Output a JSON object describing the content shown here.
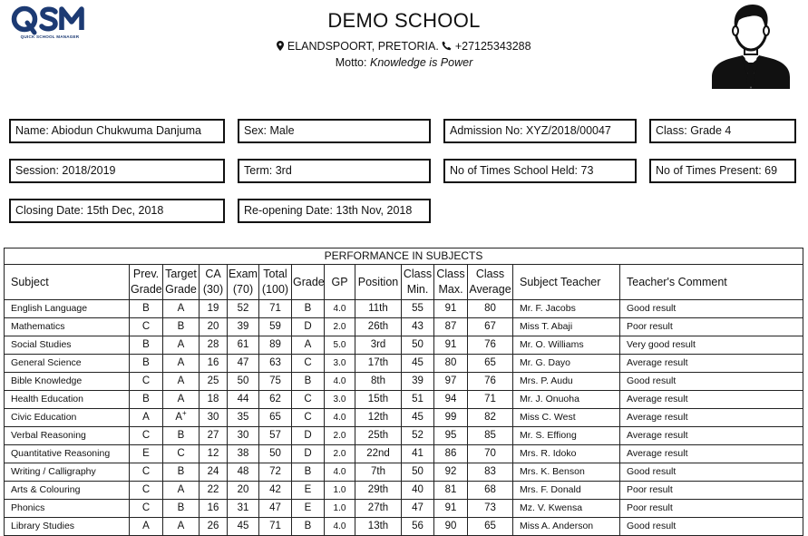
{
  "header": {
    "logo_text": "QSM",
    "logo_subtitle": "QUICK SCHOOL MANAGER",
    "school_name": "DEMO SCHOOL",
    "address": "ELANDSPOORT, PRETORIA.",
    "phone": "+27125343288",
    "motto_label": "Motto:",
    "motto": "Knowledge is Power",
    "colors": {
      "logo_blue": "#1c3a73"
    }
  },
  "student": {
    "name": "Name: Abiodun Chukwuma Danjuma",
    "sex": "Sex: Male",
    "admission": "Admission No: XYZ/2018/00047",
    "class": "Class: Grade 4",
    "session": "Session: 2018/2019",
    "term": "Term: 3rd",
    "times_held": "No of Times School Held: 73",
    "times_present": "No of Times Present: 69",
    "closing_date": "Closing Date: 15th Dec, 2018",
    "reopening_date": "Re-opening Date: 13th Nov, 2018"
  },
  "performance": {
    "title": "PERFORMANCE IN SUBJECTS",
    "headers": {
      "subject": "Subject",
      "prev_grade_1": "Prev.",
      "prev_grade_2": "Grade",
      "target_grade_1": "Target",
      "target_grade_2": "Grade",
      "ca_1": "CA",
      "ca_2": "(30)",
      "exam_1": "Exam",
      "exam_2": "(70)",
      "total_1": "Total",
      "total_2": "(100)",
      "grade": "Grade",
      "gp": "GP",
      "position": "Position",
      "class_min_1": "Class",
      "class_min_2": "Min.",
      "class_max_1": "Class",
      "class_max_2": "Max.",
      "class_avg_1": "Class",
      "class_avg_2": "Average",
      "teacher": "Subject Teacher",
      "comment": "Teacher's Comment"
    },
    "rows": [
      {
        "subject": "English Language",
        "prev": "B",
        "target": "A",
        "target_sup": "",
        "ca": "19",
        "exam": "52",
        "total": "71",
        "grade": "B",
        "gp": "4.0",
        "position": "11th",
        "min": "55",
        "max": "91",
        "avg": "80",
        "teacher": "Mr. F. Jacobs",
        "comment": "Good result"
      },
      {
        "subject": "Mathematics",
        "prev": "C",
        "target": "B",
        "target_sup": "",
        "ca": "20",
        "exam": "39",
        "total": "59",
        "grade": "D",
        "gp": "2.0",
        "position": "26th",
        "min": "43",
        "max": "87",
        "avg": "67",
        "teacher": "Miss T. Abaji",
        "comment": "Poor result"
      },
      {
        "subject": "Social Studies",
        "prev": "B",
        "target": "A",
        "target_sup": "",
        "ca": "28",
        "exam": "61",
        "total": "89",
        "grade": "A",
        "gp": "5.0",
        "position": "3rd",
        "min": "50",
        "max": "91",
        "avg": "76",
        "teacher": "Mr. O. Williams",
        "comment": "Very good result"
      },
      {
        "subject": "General Science",
        "prev": "B",
        "target": "A",
        "target_sup": "",
        "ca": "16",
        "exam": "47",
        "total": "63",
        "grade": "C",
        "gp": "3.0",
        "position": "17th",
        "min": "45",
        "max": "80",
        "avg": "65",
        "teacher": "Mr. G. Dayo",
        "comment": "Average result"
      },
      {
        "subject": "Bible Knowledge",
        "prev": "C",
        "target": "A",
        "target_sup": "",
        "ca": "25",
        "exam": "50",
        "total": "75",
        "grade": "B",
        "gp": "4.0",
        "position": "8th",
        "min": "39",
        "max": "97",
        "avg": "76",
        "teacher": "Mrs. P. Audu",
        "comment": "Good result"
      },
      {
        "subject": "Health Education",
        "prev": "B",
        "target": "A",
        "target_sup": "",
        "ca": "18",
        "exam": "44",
        "total": "62",
        "grade": "C",
        "gp": "3.0",
        "position": "15th",
        "min": "51",
        "max": "94",
        "avg": "71",
        "teacher": "Mr. J. Onuoha",
        "comment": "Average result"
      },
      {
        "subject": "Civic Education",
        "prev": "A",
        "target": "A",
        "target_sup": "+",
        "ca": "30",
        "exam": "35",
        "total": "65",
        "grade": "C",
        "gp": "4.0",
        "position": "12th",
        "min": "45",
        "max": "99",
        "avg": "82",
        "teacher": "Miss C. West",
        "comment": "Average result"
      },
      {
        "subject": "Verbal Reasoning",
        "prev": "C",
        "target": "B",
        "target_sup": "",
        "ca": "27",
        "exam": "30",
        "total": "57",
        "grade": "D",
        "gp": "2.0",
        "position": "25th",
        "min": "52",
        "max": "95",
        "avg": "85",
        "teacher": "Mr. S. Effiong",
        "comment": "Average result"
      },
      {
        "subject": "Quantitative Reasoning",
        "prev": "E",
        "target": "C",
        "target_sup": "",
        "ca": "12",
        "exam": "38",
        "total": "50",
        "grade": "D",
        "gp": "2.0",
        "position": "22nd",
        "min": "41",
        "max": "86",
        "avg": "70",
        "teacher": "Mrs. R. Idoko",
        "comment": "Average result"
      },
      {
        "subject": "Writing / Calligraphy",
        "prev": "C",
        "target": "B",
        "target_sup": "",
        "ca": "24",
        "exam": "48",
        "total": "72",
        "grade": "B",
        "gp": "4.0",
        "position": "7th",
        "min": "50",
        "max": "92",
        "avg": "83",
        "teacher": "Mrs. K. Benson",
        "comment": "Good result"
      },
      {
        "subject": "Arts & Colouring",
        "prev": "C",
        "target": "A",
        "target_sup": "",
        "ca": "22",
        "exam": "20",
        "total": "42",
        "grade": "E",
        "gp": "1.0",
        "position": "29th",
        "min": "40",
        "max": "81",
        "avg": "68",
        "teacher": "Mrs. F. Donald",
        "comment": "Poor result"
      },
      {
        "subject": "Phonics",
        "prev": "C",
        "target": "B",
        "target_sup": "",
        "ca": "16",
        "exam": "31",
        "total": "47",
        "grade": "E",
        "gp": "1.0",
        "position": "27th",
        "min": "47",
        "max": "91",
        "avg": "73",
        "teacher": "Mz. V. Kwensa",
        "comment": "Poor result"
      },
      {
        "subject": "Library Studies",
        "prev": "A",
        "target": "A",
        "target_sup": "",
        "ca": "26",
        "exam": "45",
        "total": "71",
        "grade": "B",
        "gp": "4.0",
        "position": "13th",
        "min": "56",
        "max": "90",
        "avg": "65",
        "teacher": "Miss A. Anderson",
        "comment": "Good result"
      }
    ]
  }
}
